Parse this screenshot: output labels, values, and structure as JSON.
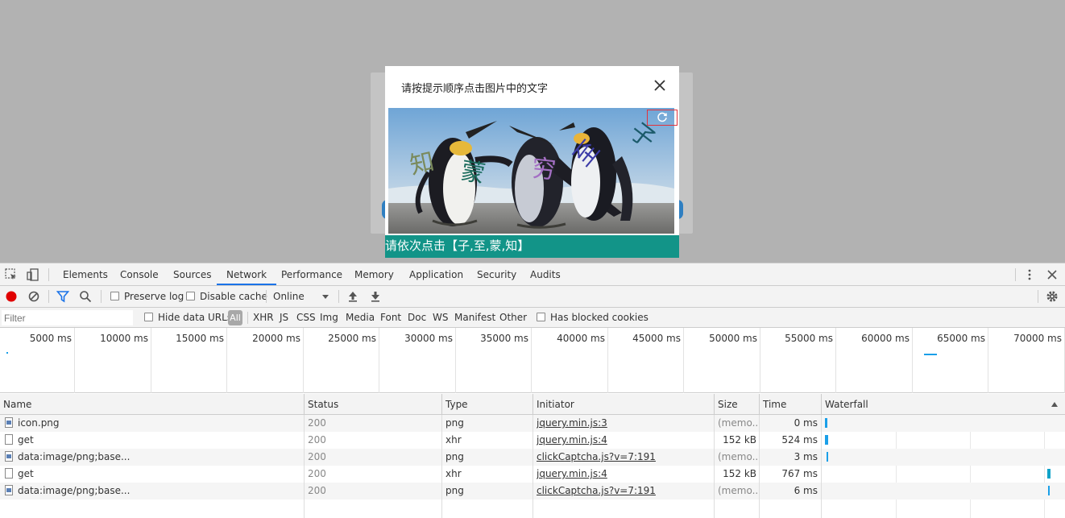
{
  "captcha": {
    "title": "请按提示顺序点击图片中的文字",
    "prompt": "请依次点击【子,至,蒙,知】",
    "chars": [
      {
        "text": "知",
        "color": "#7a8a5c"
      },
      {
        "text": "蒙",
        "color": "#1a6b5c"
      },
      {
        "text": "穷",
        "color": "#a46fc4"
      },
      {
        "text": "至",
        "color": "#3c3ca8"
      },
      {
        "text": "子",
        "color": "#1b5a6a"
      }
    ]
  },
  "devtools": {
    "tabs": [
      "Elements",
      "Console",
      "Sources",
      "Network",
      "Performance",
      "Memory",
      "Application",
      "Security",
      "Audits"
    ],
    "active_tab": "Network",
    "toolbar": {
      "preserve_log": "Preserve log",
      "disable_cache": "Disable cache",
      "throttle": "Online"
    },
    "filter": {
      "placeholder": "Filter",
      "hide_data_urls": "Hide data URLs",
      "all": "All",
      "types": [
        "XHR",
        "JS",
        "CSS",
        "Img",
        "Media",
        "Font",
        "Doc",
        "WS",
        "Manifest",
        "Other"
      ],
      "has_blocked_cookies": "Has blocked cookies"
    },
    "overview_ticks": [
      "5000 ms",
      "10000 ms",
      "15000 ms",
      "20000 ms",
      "25000 ms",
      "30000 ms",
      "35000 ms",
      "40000 ms",
      "45000 ms",
      "50000 ms",
      "55000 ms",
      "60000 ms",
      "65000 ms",
      "70000 ms"
    ],
    "columns": [
      "Name",
      "Status",
      "Type",
      "Initiator",
      "Size",
      "Time",
      "Waterfall"
    ],
    "rows": [
      {
        "name": "icon.png",
        "status": "200",
        "type": "png",
        "initiator": "jquery.min.js:3",
        "size": "(memo...",
        "time": "0 ms"
      },
      {
        "name": "get",
        "status": "200",
        "type": "xhr",
        "initiator": "jquery.min.js:4",
        "size": "152 kB",
        "time": "524 ms"
      },
      {
        "name": "data:image/png;base...",
        "status": "200",
        "type": "png",
        "initiator": "clickCaptcha.js?v=7:191",
        "size": "(memo...",
        "time": "3 ms"
      },
      {
        "name": "get",
        "status": "200",
        "type": "xhr",
        "initiator": "jquery.min.js:4",
        "size": "152 kB",
        "time": "767 ms"
      },
      {
        "name": "data:image/png;base...",
        "status": "200",
        "type": "png",
        "initiator": "clickCaptcha.js?v=7:191",
        "size": "(memo...",
        "time": "6 ms"
      }
    ]
  }
}
